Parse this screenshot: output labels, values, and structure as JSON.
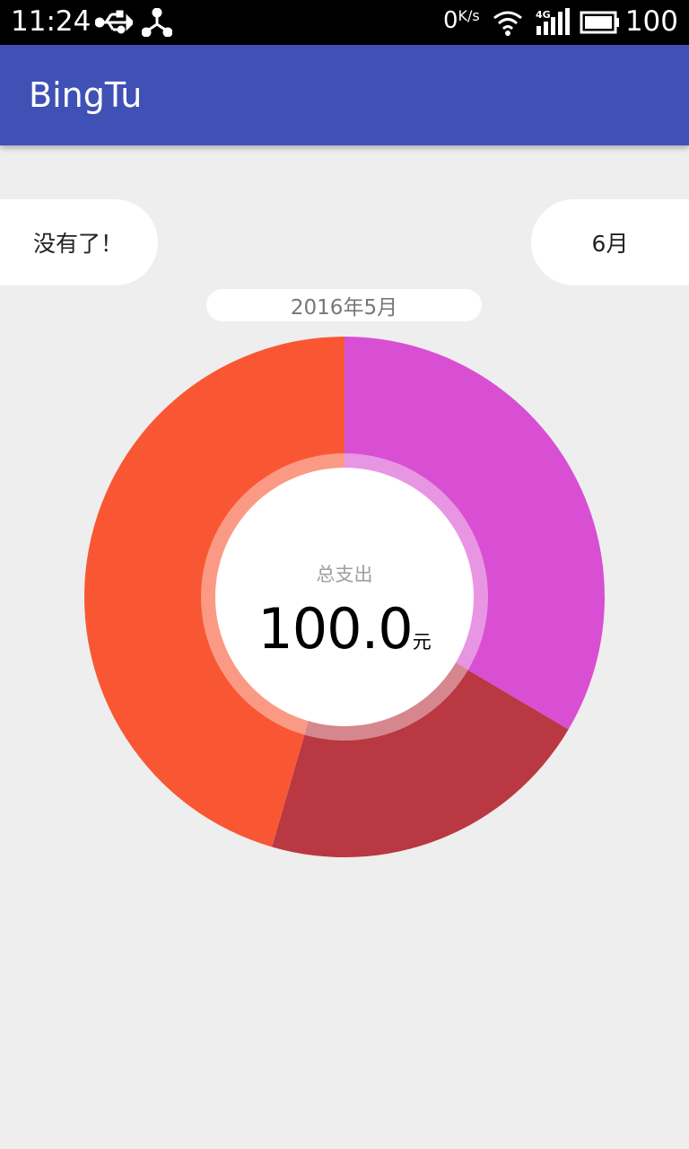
{
  "status_bar": {
    "time": "11:24",
    "speed_value": "0",
    "speed_unit": "K/s",
    "network": "4G",
    "battery": "100"
  },
  "app_bar": {
    "title": "BingTu"
  },
  "navigation": {
    "prev_label": "没有了！",
    "next_label": "6月",
    "current_month": "2016年5月"
  },
  "summary": {
    "caption": "总支出",
    "total": "100.0",
    "unit": "元"
  },
  "chart_data": {
    "type": "pie",
    "donut": true,
    "title": "",
    "slices": [
      {
        "value": 0.335,
        "color": "#d94fd3"
      },
      {
        "value": 0.21,
        "color": "#b93841"
      },
      {
        "value": 0.455,
        "color": "#f95733"
      }
    ]
  }
}
